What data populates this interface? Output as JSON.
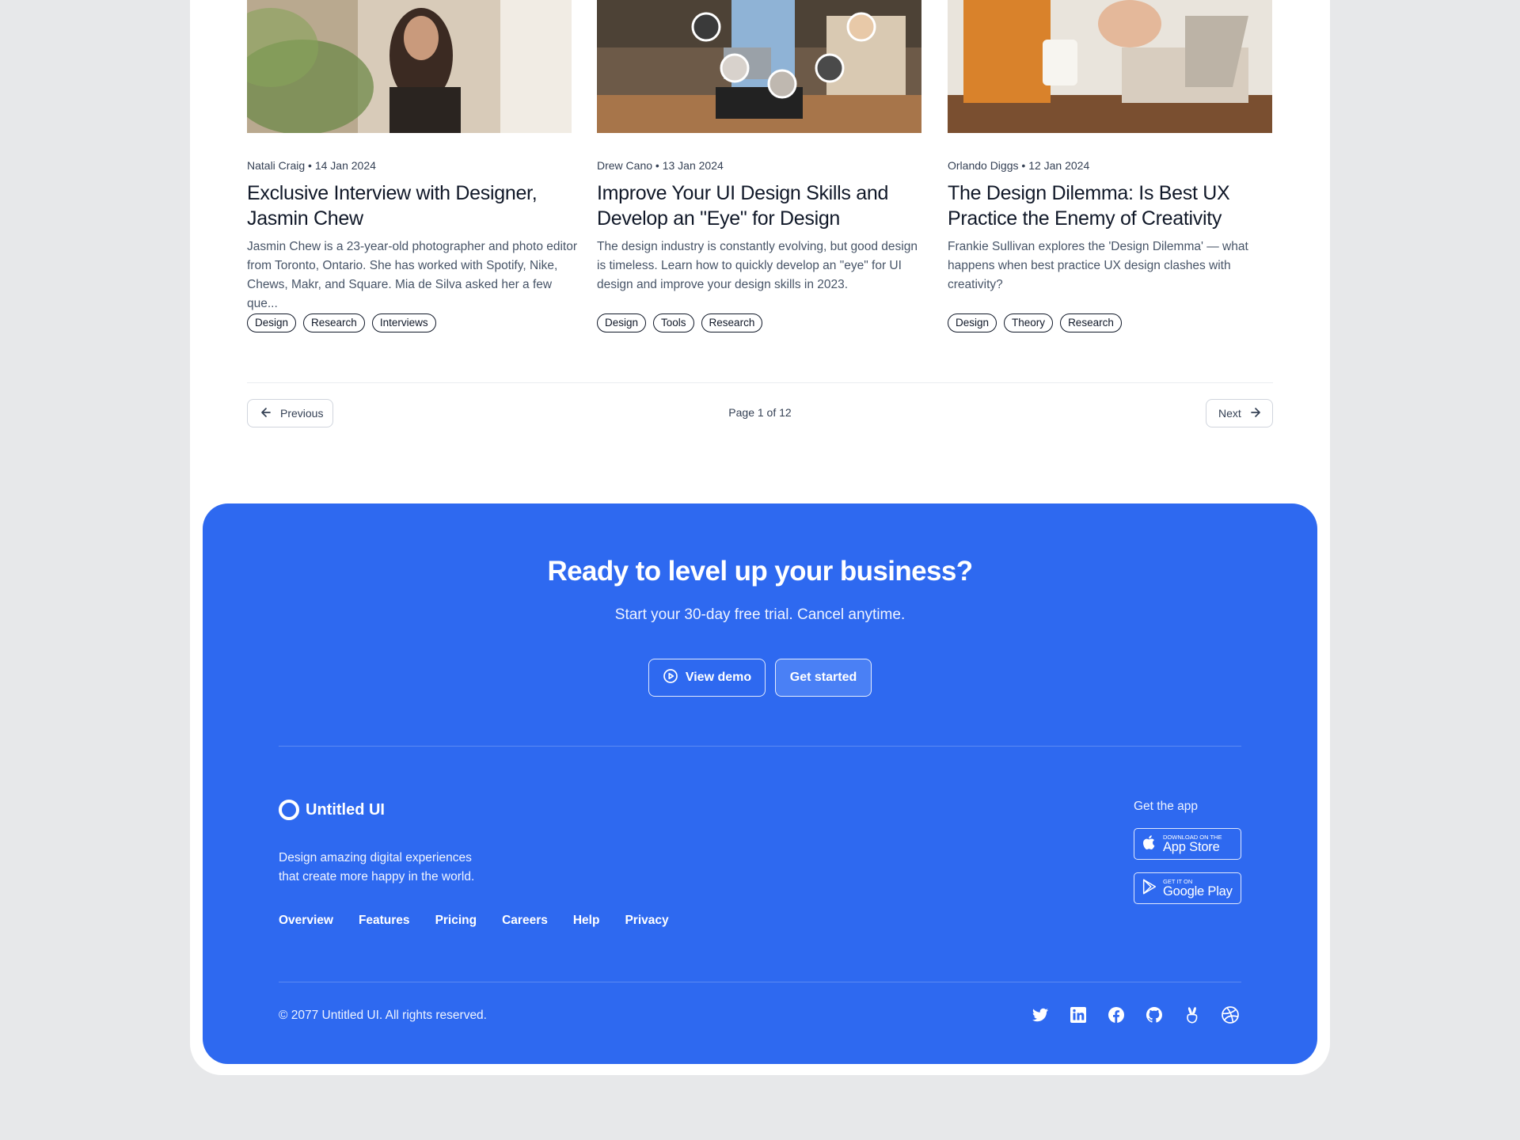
{
  "posts": [
    {
      "author": "Natali Craig",
      "date": "14 Jan 2024",
      "title": "Exclusive Interview with Designer, Jasmin Chew",
      "excerpt": "Jasmin Chew is a 23-year-old photographer and photo editor from Toronto, Ontario. She has worked with Spotify, Nike, Chews, Makr, and Square. Mia de Silva asked her a few que...",
      "tags": [
        "Design",
        "Research",
        "Interviews"
      ]
    },
    {
      "author": "Drew Cano",
      "date": "13 Jan 2024",
      "title": "Improve Your UI Design Skills and Develop an \"Eye\" for Design",
      "excerpt": "The design industry is constantly evolving, but good design is timeless. Learn how to quickly develop an \"eye\" for UI design and improve your design skills in 2023.",
      "tags": [
        "Design",
        "Tools",
        "Research"
      ]
    },
    {
      "author": "Orlando Diggs",
      "date": "12 Jan 2024",
      "title": "The Design Dilemma: Is Best UX Practice the Enemy of Creativity",
      "excerpt": "Frankie Sullivan explores the 'Design Dilemma' — what happens when best practice UX design clashes with creativity?",
      "tags": [
        "Design",
        "Theory",
        "Research"
      ]
    }
  ],
  "pagination": {
    "previous_label": "Previous",
    "page_label": "Page 1 of 12",
    "next_label": "Next"
  },
  "cta": {
    "title": "Ready to level up your business?",
    "subtitle": "Start your 30-day free trial. Cancel anytime.",
    "demo_label": "View demo",
    "start_label": "Get started"
  },
  "footer": {
    "brand": "Untitled UI",
    "tagline_line1": "Design amazing digital experiences",
    "tagline_line2": "that create more happy in the world.",
    "links": [
      "Overview",
      "Features",
      "Pricing",
      "Careers",
      "Help",
      "Privacy"
    ],
    "get_app_label": "Get the app",
    "app_store_small": "Download on the",
    "app_store_big": "App Store",
    "google_play_small": "GET IT ON",
    "google_play_big": "Google Play",
    "copyright": "© 2077 Untitled UI. All rights reserved.",
    "social_icons": [
      "twitter-icon",
      "linkedin-icon",
      "facebook-icon",
      "github-icon",
      "angellist-icon",
      "dribbble-icon"
    ]
  },
  "colors": {
    "accent": "#2e69f0",
    "page_bg": "#e7e8ea",
    "card_bg": "#ffffff",
    "text_primary": "#101828",
    "text_secondary": "#475467"
  }
}
